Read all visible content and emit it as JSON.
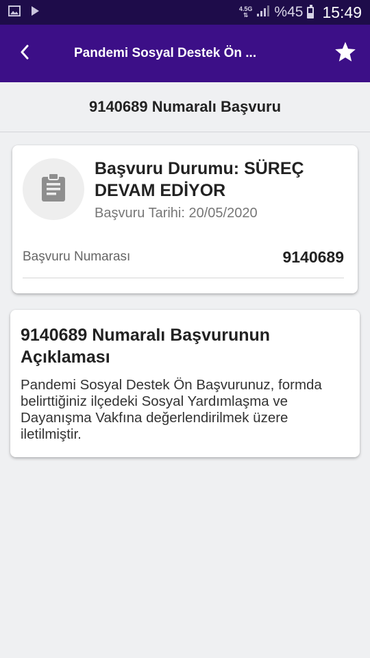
{
  "status_bar": {
    "network_top": "4.5G",
    "battery_text": "%45",
    "battery_level": 0.45,
    "time": "15:49",
    "icons": [
      "image-icon",
      "play-icon",
      "signal-icon",
      "battery-icon"
    ]
  },
  "app_bar": {
    "title": "Pandemi Sosyal Destek Ön ...",
    "back_icon": "chevron-left-icon",
    "favorite_icon": "star-icon",
    "background": "#3c0f87"
  },
  "subheader": {
    "title": "9140689 Numaralı Başvuru"
  },
  "status_card": {
    "icon": "clipboard-icon",
    "status_title": "Başvuru Durumu: SÜREÇ DEVAM EDİYOR",
    "date_text": "Başvuru Tarihi: 20/05/2020",
    "number_label": "Başvuru Numarası",
    "number_value": "9140689"
  },
  "description_card": {
    "title": "9140689 Numaralı Başvurunun Açıklaması",
    "body": "Pandemi Sosyal Destek Ön Başvurunuz, formda belirttiğiniz ilçedeki Sosyal Yardımlaşma ve Dayanışma Vakfına değerlendirilmek üzere iletilmiştir."
  }
}
